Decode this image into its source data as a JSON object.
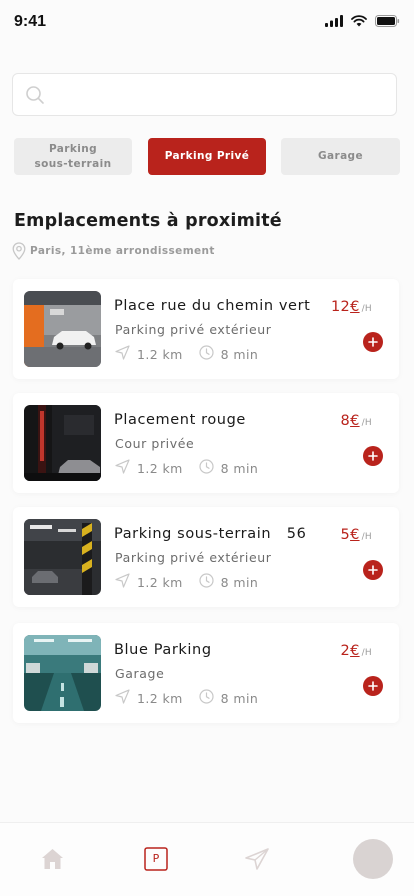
{
  "status_bar": {
    "time": "9:41"
  },
  "search": {
    "placeholder": "",
    "value": ""
  },
  "tabs": [
    {
      "label_line1": "Parking",
      "label_line2": "sous-terrain",
      "active": false
    },
    {
      "label": "Parking Privé",
      "active": true
    },
    {
      "label": "Garage",
      "active": false
    }
  ],
  "section": {
    "title": "Emplacements à proximité",
    "location": "Paris, 11ème arrondissement"
  },
  "listings": [
    {
      "title": "Place rue du chemin vert",
      "subtitle": "Parking privé extérieur",
      "distance": "1.2 km",
      "duration": "8 min",
      "price": "12",
      "currency": "€",
      "unit": "/H",
      "image": "orange-garage"
    },
    {
      "title": "Placement rouge",
      "subtitle": "Cour privée",
      "distance": "1.2 km",
      "duration": "8 min",
      "price": "8",
      "currency": "€",
      "unit": "/H",
      "image": "dark-red-parking"
    },
    {
      "title": "Parking sous-terrain   56",
      "subtitle": "Parking privé extérieur",
      "distance": "1.2 km",
      "duration": "8 min",
      "price": "5",
      "currency": "€",
      "unit": "/H",
      "image": "underground-lights"
    },
    {
      "title": "Blue Parking",
      "subtitle": "Garage",
      "distance": "1.2 km",
      "duration": "8 min",
      "price": "2",
      "currency": "€",
      "unit": "/H",
      "image": "blue-teal-parking"
    }
  ],
  "bottom_nav": [
    {
      "icon": "home-icon"
    },
    {
      "icon": "parking-icon",
      "label": "P"
    },
    {
      "icon": "send-icon"
    },
    {
      "icon": "avatar"
    }
  ],
  "colors": {
    "accent": "#b9231c",
    "tab_inactive": "#ececec",
    "text_muted": "#8a8a8a"
  }
}
